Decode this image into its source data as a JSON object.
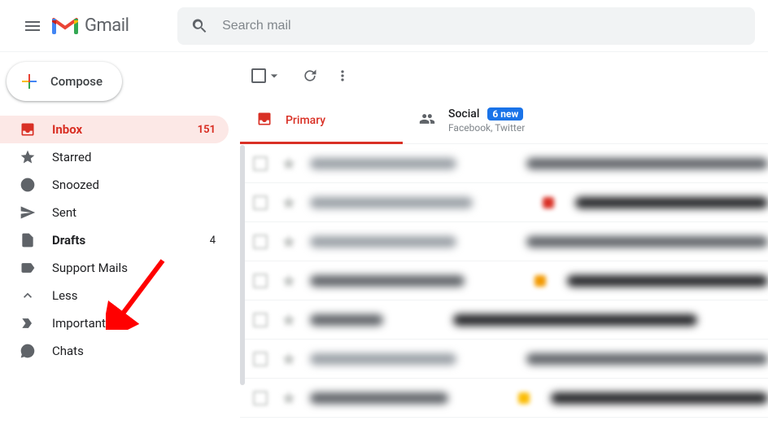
{
  "header": {
    "app_name": "Gmail",
    "search_placeholder": "Search mail"
  },
  "compose": {
    "label": "Compose"
  },
  "sidebar": {
    "items": [
      {
        "label": "Inbox",
        "count": "151"
      },
      {
        "label": "Starred"
      },
      {
        "label": "Snoozed"
      },
      {
        "label": "Sent"
      },
      {
        "label": "Drafts",
        "count": "4"
      },
      {
        "label": "Support Mails"
      },
      {
        "label": "Less"
      },
      {
        "label": "Important"
      },
      {
        "label": "Chats"
      }
    ]
  },
  "tabs": {
    "primary": {
      "label": "Primary"
    },
    "social": {
      "label": "Social",
      "badge": "6 new",
      "sub": "Facebook, Twitter"
    }
  }
}
